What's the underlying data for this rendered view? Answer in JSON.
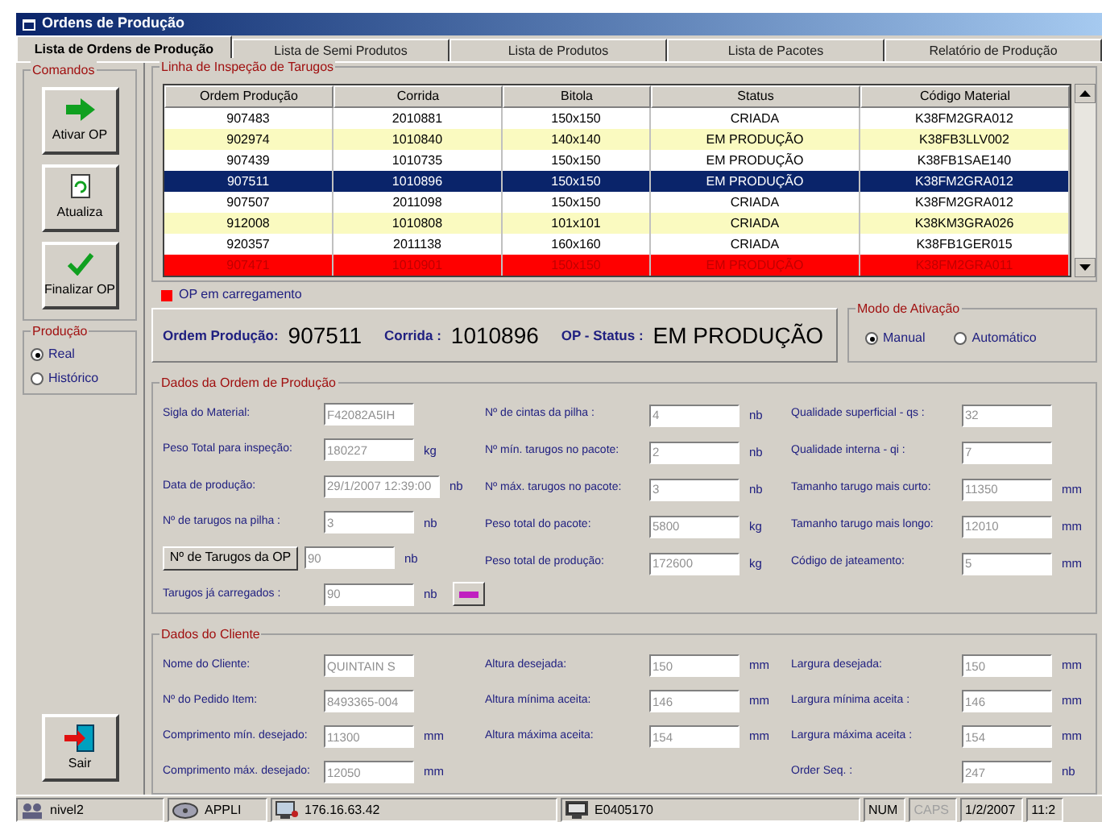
{
  "window": {
    "title": "Ordens de Produção"
  },
  "tabs": [
    {
      "label": "Lista de Ordens de Produção",
      "selected": true
    },
    {
      "label": "Lista de Semi Produtos",
      "selected": false
    },
    {
      "label": "Lista de Produtos",
      "selected": false
    },
    {
      "label": "Lista de Pacotes",
      "selected": false
    },
    {
      "label": "Relatório de Produção",
      "selected": false
    }
  ],
  "commands": {
    "title": "Comandos",
    "buttons": [
      {
        "kind": "activate",
        "label": "Ativar OP"
      },
      {
        "kind": "refresh",
        "label": "Atualiza"
      },
      {
        "kind": "finish",
        "label": "Finalizar OP"
      }
    ]
  },
  "production": {
    "title": "Produção",
    "options": [
      {
        "label": "Real",
        "selected": true
      },
      {
        "label": "Histórico",
        "selected": false
      }
    ]
  },
  "exit_button": {
    "label": "Sair"
  },
  "table": {
    "title": "Linha de Inspeção de Tarugos",
    "columns": [
      "Ordem Produção",
      "Corrida",
      "Bitola",
      "Status",
      "Código Material"
    ],
    "rows": [
      {
        "cells": [
          "907483",
          "2010881",
          "150x150",
          "CRIADA",
          "K38FM2GRA012"
        ],
        "selected": false,
        "loading": false
      },
      {
        "cells": [
          "902974",
          "1010840",
          "140x140",
          "EM PRODUÇÃO",
          "K38FB3LLV002"
        ],
        "selected": false,
        "loading": false
      },
      {
        "cells": [
          "907439",
          "1010735",
          "150x150",
          "EM PRODUÇÃO",
          "K38FB1SAE140"
        ],
        "selected": false,
        "loading": false
      },
      {
        "cells": [
          "907511",
          "1010896",
          "150x150",
          "EM PRODUÇÃO",
          "K38FM2GRA012"
        ],
        "selected": true,
        "loading": false
      },
      {
        "cells": [
          "907507",
          "2011098",
          "150x150",
          "CRIADA",
          "K38FM2GRA012"
        ],
        "selected": false,
        "loading": false
      },
      {
        "cells": [
          "912008",
          "1010808",
          "101x101",
          "CRIADA",
          "K38KM3GRA026"
        ],
        "selected": false,
        "loading": false
      },
      {
        "cells": [
          "920357",
          "2011138",
          "160x160",
          "CRIADA",
          "K38FB1GER015"
        ],
        "selected": false,
        "loading": false
      },
      {
        "cells": [
          "907471",
          "1010901",
          "150x150",
          "EM PRODUÇÃO",
          "K38FM2GRA011"
        ],
        "selected": false,
        "loading": true
      }
    ]
  },
  "legend": {
    "label": "OP em carregamento",
    "color": "#ff0000"
  },
  "summary": {
    "order_label": "Ordem Produção:",
    "order": "907511",
    "heat_label": "Corrida :",
    "heat": "1010896",
    "status_label": "OP - Status :",
    "status": "EM PRODUÇÃO"
  },
  "activation_mode": {
    "title": "Modo de Ativação",
    "options": [
      {
        "label": "Manual",
        "selected": true
      },
      {
        "label": "Automático",
        "selected": false
      }
    ]
  },
  "order_data": {
    "title": "Dados da Ordem de Produção",
    "columns": [
      [
        {
          "kind": "field",
          "label": "Sigla do Material:",
          "value": "F42082A5IH"
        },
        {
          "kind": "field",
          "label": "Peso Total para inspeção:",
          "value": "180227",
          "unit": "kg"
        },
        {
          "kind": "field",
          "label": "Data de produção:",
          "value": "29/1/2007 12:39:00",
          "unit": "nb"
        },
        {
          "kind": "field",
          "label": "Nº de tarugos na pilha :",
          "value": "3",
          "unit": "nb"
        },
        {
          "kind": "button",
          "label": "Nº de Tarugos da OP",
          "value": "90",
          "unit": "nb"
        },
        {
          "kind": "field",
          "label": "Tarugos já carregados :",
          "value": "90",
          "unit": "nb",
          "extra_button": true
        }
      ],
      [
        {
          "kind": "field",
          "label": "Nº de cintas da pilha :",
          "value": "4",
          "unit": "nb"
        },
        {
          "kind": "field",
          "label": "Nº mín. tarugos no pacote:",
          "value": "2",
          "unit": "nb"
        },
        {
          "kind": "field",
          "label": "Nº máx. tarugos no pacote:",
          "value": "3",
          "unit": "nb"
        },
        {
          "kind": "field",
          "label": "Peso total do pacote:",
          "value": "5800",
          "unit": "kg"
        },
        {
          "kind": "field",
          "label": "Peso total de produção:",
          "value": "172600",
          "unit": "kg"
        }
      ],
      [
        {
          "kind": "field",
          "label": "Qualidade superficial - qs :",
          "value": "32"
        },
        {
          "kind": "field",
          "label": "Qualidade interna - qi :",
          "value": "7"
        },
        {
          "kind": "field",
          "label": "Tamanho tarugo mais curto:",
          "value": "11350",
          "unit": "mm"
        },
        {
          "kind": "field",
          "label": "Tamanho tarugo mais longo:",
          "value": "12010",
          "unit": "mm"
        },
        {
          "kind": "field",
          "label": "Código de jateamento:",
          "value": "5",
          "unit": "mm"
        }
      ]
    ]
  },
  "client_data": {
    "title": "Dados do Cliente",
    "columns": [
      [
        {
          "kind": "field",
          "label": "Nome do Cliente:",
          "value": "QUINTAIN S"
        },
        {
          "kind": "field",
          "label": "Nº do Pedido Item:",
          "value": "8493365-004"
        },
        {
          "kind": "field",
          "label": "Comprimento mín. desejado:",
          "value": "11300",
          "unit": "mm"
        },
        {
          "kind": "field",
          "label": "Comprimento máx. desejado:",
          "value": "12050",
          "unit": "mm"
        }
      ],
      [
        {
          "kind": "field",
          "label": "Altura desejada:",
          "value": "150",
          "unit": "mm"
        },
        {
          "kind": "field",
          "label": "Altura mínima aceita:",
          "value": "146",
          "unit": "mm"
        },
        {
          "kind": "field",
          "label": "Altura máxima aceita:",
          "value": "154",
          "unit": "mm"
        }
      ],
      [
        {
          "kind": "field",
          "label": "Largura desejada:",
          "value": "150",
          "unit": "mm"
        },
        {
          "kind": "field",
          "label": "Largura mínima aceita :",
          "value": "146",
          "unit": "mm"
        },
        {
          "kind": "field",
          "label": "Largura máxima aceita :",
          "value": "154",
          "unit": "mm"
        },
        {
          "kind": "field",
          "label": "Order Seq. :",
          "value": "247",
          "unit": "nb"
        }
      ]
    ]
  },
  "status_bar": [
    {
      "kind": "user",
      "text": "nivel2",
      "disabled": false
    },
    {
      "kind": "app",
      "text": "APPLI",
      "disabled": false
    },
    {
      "kind": "network",
      "text": "176.16.63.42",
      "disabled": false
    },
    {
      "kind": "computer",
      "text": "E0405170",
      "disabled": false
    },
    {
      "kind": "plain",
      "text": "NUM",
      "disabled": false
    },
    {
      "kind": "plain",
      "text": "CAPS",
      "disabled": true
    },
    {
      "kind": "plain",
      "text": "1/2/2007",
      "disabled": false
    },
    {
      "kind": "plain",
      "text": "11:2",
      "disabled": false
    }
  ]
}
